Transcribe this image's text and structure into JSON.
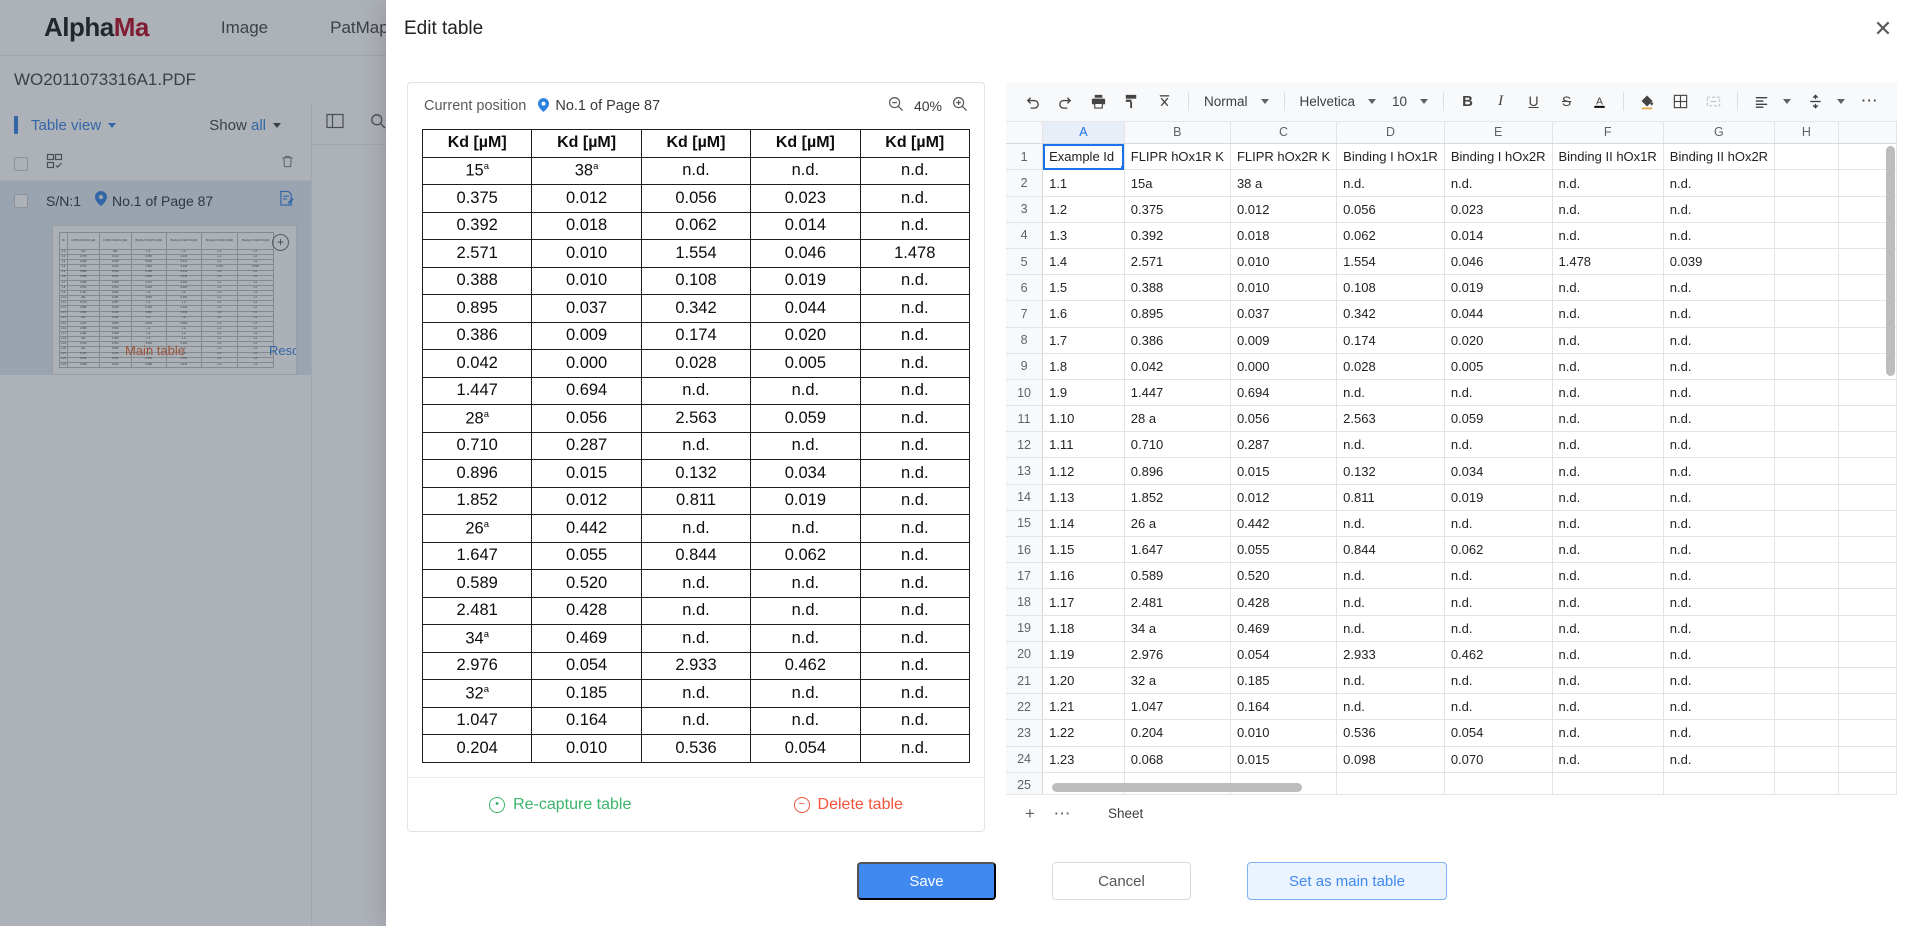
{
  "app": {
    "logo": {
      "part1": "Alpha",
      "part2": "Ma",
      "part3": ""
    },
    "nav": [
      {
        "label": "Image",
        "name": "nav-image"
      },
      {
        "label": "PatMap",
        "name": "nav-patmap"
      }
    ],
    "document_name": "WO2011073316A1.PDF"
  },
  "sidebar": {
    "view_mode": "Table view",
    "show_all_prefix": "Show ",
    "show_all_suffix": "all",
    "item": {
      "serial": "S/N:1",
      "position": "No.1 of Page 87",
      "badge_main": "Main table",
      "badge_resolved": "Resolved"
    },
    "thumbnail": {
      "headers": [
        "No",
        "FLIPR hOx1R Kd [µM]",
        "FLIPR hOx2R Kd [µM]",
        "Binding I hOx1R Kd [µM]",
        "Binding I hOx2R Kd [µM]",
        "Binding II hOx1R Kd [µM]",
        "Binding II hOx2R Kd [µM]"
      ],
      "rows": [
        [
          "1.1",
          "15a",
          "38a",
          "n.d.",
          "n.d.",
          "n.d.",
          "n.d."
        ],
        [
          "1.2",
          "0.375",
          "0.012",
          "0.056",
          "0.023",
          "n.d.",
          "n.d."
        ],
        [
          "1.3",
          "0.392",
          "0.018",
          "0.062",
          "0.014",
          "n.d.",
          "n.d."
        ],
        [
          "1.4",
          "2.571",
          "0.010",
          "1.554",
          "0.046",
          "1.478",
          "0.039"
        ],
        [
          "1.5",
          "0.388",
          "0.010",
          "0.108",
          "0.019",
          "n.d.",
          "n.d."
        ],
        [
          "1.6",
          "0.895",
          "0.037",
          "0.342",
          "0.044",
          "n.d.",
          "n.d."
        ],
        [
          "1.7",
          "0.386",
          "0.009",
          "0.174",
          "0.020",
          "n.d.",
          "n.d."
        ],
        [
          "1.8",
          "0.042",
          "0.000",
          "0.028",
          "0.005",
          "n.d.",
          "n.d."
        ],
        [
          "1.9",
          "1.447",
          "0.694",
          "n.d.",
          "n.d.",
          "n.d.",
          "n.d."
        ],
        [
          "1.10",
          "28a",
          "0.056",
          "2.563",
          "0.059",
          "n.d.",
          "n.d."
        ],
        [
          "1.11",
          "0.710",
          "0.287",
          "n.d.",
          "n.d.",
          "n.d.",
          "n.d."
        ],
        [
          "1.12",
          "0.896",
          "0.015",
          "0.132",
          "0.034",
          "n.d.",
          "n.d."
        ],
        [
          "1.13",
          "1.852",
          "0.012",
          "0.811",
          "0.019",
          "n.d.",
          "n.d."
        ],
        [
          "1.14",
          "26a",
          "0.442",
          "n.d.",
          "n.d.",
          "n.d.",
          "n.d."
        ],
        [
          "1.15",
          "1.647",
          "0.055",
          "0.844",
          "0.062",
          "n.d.",
          "n.d."
        ],
        [
          "1.16",
          "0.589",
          "0.520",
          "n.d.",
          "n.d.",
          "n.d.",
          "n.d."
        ],
        [
          "1.17",
          "2.481",
          "0.428",
          "n.d.",
          "n.d.",
          "n.d.",
          "n.d."
        ],
        [
          "1.18",
          "34a",
          "0.469",
          "n.d.",
          "n.d.",
          "n.d.",
          "n.d."
        ],
        [
          "1.19",
          "2.976",
          "0.054",
          "2.933",
          "0.462",
          "n.d.",
          "n.d."
        ],
        [
          "1.20",
          "32a",
          "0.185",
          "n.d.",
          "n.d.",
          "n.d.",
          "n.d."
        ],
        [
          "1.21",
          "1.047",
          "0.164",
          "n.d.",
          "n.d.",
          "n.d.",
          "n.d."
        ],
        [
          "1.22",
          "0.204",
          "0.010",
          "0.536",
          "0.054",
          "n.d.",
          "n.d."
        ],
        [
          "1.23",
          "0.068",
          "0.015",
          "0.098",
          "0.070",
          "n.d.",
          "n.d."
        ]
      ]
    }
  },
  "modal": {
    "title": "Edit table",
    "close_glyph": "✕"
  },
  "preview": {
    "current_position_label": "Current position",
    "position_value": "No.1 of Page 87",
    "zoom_level": "40%",
    "recapture_label": "Re-capture table",
    "delete_label": "Delete table",
    "pdf_table": {
      "headers": [
        "Kd [µM]",
        "Kd [µM]",
        "Kd [µM]",
        "Kd [µM]",
        "Kd [µM]"
      ],
      "rows": [
        [
          {
            "t": "15",
            "sup": "a"
          },
          {
            "t": "38",
            "sup": "a"
          },
          {
            "t": "n.d."
          },
          {
            "t": "n.d."
          },
          {
            "t": "n.d."
          }
        ],
        [
          {
            "t": "0.375"
          },
          {
            "t": "0.012"
          },
          {
            "t": "0.056"
          },
          {
            "t": "0.023"
          },
          {
            "t": "n.d."
          }
        ],
        [
          {
            "t": "0.392"
          },
          {
            "t": "0.018"
          },
          {
            "t": "0.062"
          },
          {
            "t": "0.014"
          },
          {
            "t": "n.d."
          }
        ],
        [
          {
            "t": "2.571"
          },
          {
            "t": "0.010"
          },
          {
            "t": "1.554"
          },
          {
            "t": "0.046"
          },
          {
            "t": "1.478"
          }
        ],
        [
          {
            "t": "0.388"
          },
          {
            "t": "0.010"
          },
          {
            "t": "0.108"
          },
          {
            "t": "0.019"
          },
          {
            "t": "n.d."
          }
        ],
        [
          {
            "t": "0.895"
          },
          {
            "t": "0.037"
          },
          {
            "t": "0.342"
          },
          {
            "t": "0.044"
          },
          {
            "t": "n.d."
          }
        ],
        [
          {
            "t": "0.386"
          },
          {
            "t": "0.009"
          },
          {
            "t": "0.174"
          },
          {
            "t": "0.020"
          },
          {
            "t": "n.d."
          }
        ],
        [
          {
            "t": "0.042"
          },
          {
            "t": "0.000"
          },
          {
            "t": "0.028"
          },
          {
            "t": "0.005"
          },
          {
            "t": "n.d."
          }
        ],
        [
          {
            "t": "1.447"
          },
          {
            "t": "0.694"
          },
          {
            "t": "n.d."
          },
          {
            "t": "n.d."
          },
          {
            "t": "n.d."
          }
        ],
        [
          {
            "t": "28",
            "sup": "a"
          },
          {
            "t": "0.056"
          },
          {
            "t": "2.563"
          },
          {
            "t": "0.059"
          },
          {
            "t": "n.d."
          }
        ],
        [
          {
            "t": "0.710"
          },
          {
            "t": "0.287"
          },
          {
            "t": "n.d."
          },
          {
            "t": "n.d."
          },
          {
            "t": "n.d."
          }
        ],
        [
          {
            "t": "0.896"
          },
          {
            "t": "0.015"
          },
          {
            "t": "0.132"
          },
          {
            "t": "0.034"
          },
          {
            "t": "n.d."
          }
        ],
        [
          {
            "t": "1.852"
          },
          {
            "t": "0.012"
          },
          {
            "t": "0.811"
          },
          {
            "t": "0.019"
          },
          {
            "t": "n.d."
          }
        ],
        [
          {
            "t": "26",
            "sup": "a"
          },
          {
            "t": "0.442"
          },
          {
            "t": "n.d."
          },
          {
            "t": "n.d."
          },
          {
            "t": "n.d."
          }
        ],
        [
          {
            "t": "1.647"
          },
          {
            "t": "0.055"
          },
          {
            "t": "0.844"
          },
          {
            "t": "0.062"
          },
          {
            "t": "n.d."
          }
        ],
        [
          {
            "t": "0.589"
          },
          {
            "t": "0.520"
          },
          {
            "t": "n.d."
          },
          {
            "t": "n.d."
          },
          {
            "t": "n.d."
          }
        ],
        [
          {
            "t": "2.481"
          },
          {
            "t": "0.428"
          },
          {
            "t": "n.d."
          },
          {
            "t": "n.d."
          },
          {
            "t": "n.d."
          }
        ],
        [
          {
            "t": "34",
            "sup": "a"
          },
          {
            "t": "0.469"
          },
          {
            "t": "n.d."
          },
          {
            "t": "n.d."
          },
          {
            "t": "n.d."
          }
        ],
        [
          {
            "t": "2.976"
          },
          {
            "t": "0.054"
          },
          {
            "t": "2.933"
          },
          {
            "t": "0.462"
          },
          {
            "t": "n.d."
          }
        ],
        [
          {
            "t": "32",
            "sup": "a"
          },
          {
            "t": "0.185"
          },
          {
            "t": "n.d."
          },
          {
            "t": "n.d."
          },
          {
            "t": "n.d."
          }
        ],
        [
          {
            "t": "1.047"
          },
          {
            "t": "0.164"
          },
          {
            "t": "n.d."
          },
          {
            "t": "n.d."
          },
          {
            "t": "n.d."
          }
        ],
        [
          {
            "t": "0.204"
          },
          {
            "t": "0.010"
          },
          {
            "t": "0.536"
          },
          {
            "t": "0.054"
          },
          {
            "t": "n.d."
          }
        ]
      ]
    }
  },
  "spreadsheet": {
    "toolbar": {
      "style_label": "Normal",
      "font_label": "Helvetica",
      "size_label": "10"
    },
    "column_letters": [
      "A",
      "B",
      "C",
      "D",
      "E",
      "F",
      "G",
      "H"
    ],
    "selected_column": "A",
    "active_cell": "A1",
    "rows": [
      {
        "n": "1",
        "cells": [
          "Example Id",
          "FLIPR hOx1R K",
          "FLIPR hOx2R K",
          "Binding I hOx1R",
          "Binding I hOx2R",
          "Binding II hOx1R",
          "Binding II hOx2R",
          ""
        ]
      },
      {
        "n": "2",
        "cells": [
          "1.1",
          "15a",
          "38 a",
          "n.d.",
          "n.d.",
          "n.d.",
          "n.d.",
          ""
        ]
      },
      {
        "n": "3",
        "cells": [
          "1.2",
          "0.375",
          "0.012",
          "0.056",
          "0.023",
          "n.d.",
          "n.d.",
          ""
        ]
      },
      {
        "n": "4",
        "cells": [
          "1.3",
          "0.392",
          "0.018",
          "0.062",
          "0.014",
          "n.d.",
          "n.d.",
          ""
        ]
      },
      {
        "n": "5",
        "cells": [
          "1.4",
          "2.571",
          "0.010",
          "1.554",
          "0.046",
          "1.478",
          "0.039",
          ""
        ]
      },
      {
        "n": "6",
        "cells": [
          "1.5",
          "0.388",
          "0.010",
          "0.108",
          "0.019",
          "n.d.",
          "n.d.",
          ""
        ]
      },
      {
        "n": "7",
        "cells": [
          "1.6",
          "0.895",
          "0.037",
          "0.342",
          "0.044",
          "n.d.",
          "n.d.",
          ""
        ]
      },
      {
        "n": "8",
        "cells": [
          "1.7",
          "0.386",
          "0.009",
          "0.174",
          "0.020",
          "n.d.",
          "n.d.",
          ""
        ]
      },
      {
        "n": "9",
        "cells": [
          "1.8",
          "0.042",
          "0.000",
          "0.028",
          "0.005",
          "n.d.",
          "n.d.",
          ""
        ]
      },
      {
        "n": "10",
        "cells": [
          "1.9",
          "1.447",
          "0.694",
          "n.d.",
          "n.d.",
          "n.d.",
          "n.d.",
          ""
        ]
      },
      {
        "n": "11",
        "cells": [
          "1.10",
          "28 a",
          "0.056",
          "2.563",
          "0.059",
          "n.d.",
          "n.d.",
          ""
        ]
      },
      {
        "n": "12",
        "cells": [
          "1.11",
          "0.710",
          "0.287",
          "n.d.",
          "n.d.",
          "n.d.",
          "n.d.",
          ""
        ]
      },
      {
        "n": "13",
        "cells": [
          "1.12",
          "0.896",
          "0.015",
          "0.132",
          "0.034",
          "n.d.",
          "n.d.",
          ""
        ]
      },
      {
        "n": "14",
        "cells": [
          "1.13",
          "1.852",
          "0.012",
          "0.811",
          "0.019",
          "n.d.",
          "n.d.",
          ""
        ]
      },
      {
        "n": "15",
        "cells": [
          "1.14",
          "26 a",
          "0.442",
          "n.d.",
          "n.d.",
          "n.d.",
          "n.d.",
          ""
        ]
      },
      {
        "n": "16",
        "cells": [
          "1.15",
          "1.647",
          "0.055",
          "0.844",
          "0.062",
          "n.d.",
          "n.d.",
          ""
        ]
      },
      {
        "n": "17",
        "cells": [
          "1.16",
          "0.589",
          "0.520",
          "n.d.",
          "n.d.",
          "n.d.",
          "n.d.",
          ""
        ]
      },
      {
        "n": "18",
        "cells": [
          "1.17",
          "2.481",
          "0.428",
          "n.d.",
          "n.d.",
          "n.d.",
          "n.d.",
          ""
        ]
      },
      {
        "n": "19",
        "cells": [
          "1.18",
          "34 a",
          "0.469",
          "n.d.",
          "n.d.",
          "n.d.",
          "n.d.",
          ""
        ]
      },
      {
        "n": "20",
        "cells": [
          "1.19",
          "2.976",
          "0.054",
          "2.933",
          "0.462",
          "n.d.",
          "n.d.",
          ""
        ]
      },
      {
        "n": "21",
        "cells": [
          "1.20",
          "32 a",
          "0.185",
          "n.d.",
          "n.d.",
          "n.d.",
          "n.d.",
          ""
        ]
      },
      {
        "n": "22",
        "cells": [
          "1.21",
          "1.047",
          "0.164",
          "n.d.",
          "n.d.",
          "n.d.",
          "n.d.",
          ""
        ]
      },
      {
        "n": "23",
        "cells": [
          "1.22",
          "0.204",
          "0.010",
          "0.536",
          "0.054",
          "n.d.",
          "n.d.",
          ""
        ]
      },
      {
        "n": "24",
        "cells": [
          "1.23",
          "0.068",
          "0.015",
          "0.098",
          "0.070",
          "n.d.",
          "n.d.",
          ""
        ]
      },
      {
        "n": "25",
        "cells": [
          "",
          "",
          "",
          "",
          "",
          "",
          "",
          ""
        ]
      }
    ],
    "sheet_tab": "Sheet"
  },
  "footer": {
    "save": "Save",
    "cancel": "Cancel",
    "set_main": "Set as main table"
  },
  "colors": {
    "accent": "#4089f0",
    "green": "#3ab56a",
    "red": "#f4533c",
    "brand_red": "#b3001b"
  }
}
